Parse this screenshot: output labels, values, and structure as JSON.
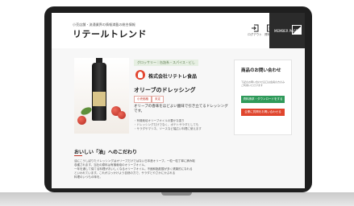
{
  "header": {
    "logo_subtitle": "小売店舗・流通業界の情報満載の総合情報",
    "logo_text": "リテールトレンド",
    "logout_label": "ログアウト",
    "data_label": "資料請求",
    "mypage_label": "MEMBER PAGE"
  },
  "product": {
    "category": "グロッサリー｜缶詰系・スパイス・ビし",
    "company": "株式会社リテトレ食品",
    "name": "オリーブのドレッシング",
    "badges": [
      "小売価格",
      "未定"
    ],
    "description": "オリーブの香味をほどよい酸味で引き立てるドレッシングです。",
    "bullets": [
      "・有機栽培オリーブオイルの豊かな香り",
      "・ドレッシングだけでなく、ポテトサラダとしても",
      "・サラダやマリネ、ソースなど幅広い料理に使えます"
    ]
  },
  "contact": {
    "title": "商品のお問い合わせ",
    "note": "下記のお問い合わせ窓口は会員の方のみご利用いただけます",
    "download_button": "資料請求・ダウンロードをする",
    "inquiry_button": "企業に質問をお問い合わせる"
  },
  "section": {
    "title": "おいしい「油」へのこだわり",
    "lines": [
      "油にこうしぼりたドレッシングはオリーブだけではない日本産オリーブ。一粒一粒丁寧に摘み取り、",
      "収穫されます。当社の原料は有機栽培のオリーブオイル、",
      "一年を通して保てる料理がおいしくなるオリーブオイル。不飽和脂肪酸が多く健康的になれる",
      "といわれています。これがぶっかけよう自然の力で、サラダとやさかにかぶれる",
      "料理のいつもの味を。"
    ]
  },
  "colors": {
    "green_button": "#2f9a5a",
    "red_button": "#e0452d",
    "dark": "#2b2b2b"
  }
}
